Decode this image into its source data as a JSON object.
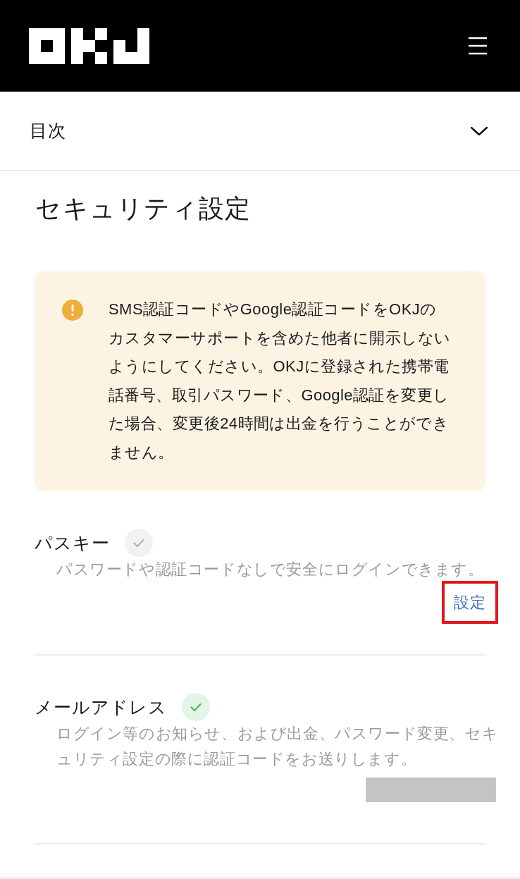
{
  "toc": {
    "label": "目次",
    "expanded": false
  },
  "title": "セキュリティ設定",
  "notice": {
    "text": "SMS認証コードやGoogle認証コードをOKJのカスタマーサポートを含めた他者に開示しないようにしてください。OKJに登録された携帯電話番号、取引パスワード、Google認証を変更した場合、変更後24時間は出金を行うことができません。"
  },
  "items": [
    {
      "title": "パスキー",
      "verified": false,
      "description": "パスワードや認証コードなしで安全にログインできます。",
      "action": {
        "label": "設定",
        "highlighted": true
      }
    },
    {
      "title": "メールアドレス",
      "verified": true,
      "description": "ログイン等のお知らせ、および出金、パスワード変更、セキュリティ設定の際に認証コードをお送りします。",
      "redacted_value": true
    }
  ]
}
